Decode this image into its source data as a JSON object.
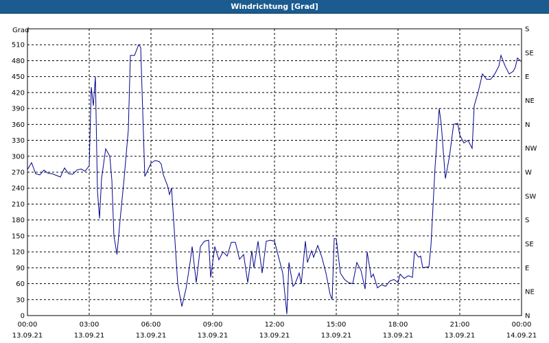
{
  "window": {
    "title": "Windrichtung [Grad]"
  },
  "colors": {
    "titlebar": "#1b5b8f",
    "series": "#00008b",
    "grid": "#000000",
    "background": "#ffffff"
  },
  "chart_data": {
    "type": "line",
    "title": "Windrichtung [Grad]",
    "ylabel": "Grad",
    "xlabel": "",
    "ylim": [
      0,
      540
    ],
    "y_ticks": [
      0,
      30,
      60,
      90,
      120,
      150,
      180,
      210,
      240,
      270,
      300,
      330,
      360,
      390,
      420,
      450,
      480,
      510
    ],
    "right_labels": [
      {
        "y": 0,
        "label": "N"
      },
      {
        "y": 45,
        "label": "NE"
      },
      {
        "y": 90,
        "label": "E"
      },
      {
        "y": 135,
        "label": "SE"
      },
      {
        "y": 180,
        "label": "S"
      },
      {
        "y": 225,
        "label": "SW"
      },
      {
        "y": 270,
        "label": "W"
      },
      {
        "y": 315,
        "label": "NW"
      },
      {
        "y": 360,
        "label": "N"
      },
      {
        "y": 405,
        "label": "NE"
      },
      {
        "y": 450,
        "label": "E"
      },
      {
        "y": 495,
        "label": "SE"
      },
      {
        "y": 540,
        "label": "S"
      }
    ],
    "x_ticks": [
      {
        "h": 0,
        "time": "00:00",
        "date": "13.09.21"
      },
      {
        "h": 3,
        "time": "03:00",
        "date": "13.09.21"
      },
      {
        "h": 6,
        "time": "06:00",
        "date": "13.09.21"
      },
      {
        "h": 9,
        "time": "09:00",
        "date": "13.09.21"
      },
      {
        "h": 12,
        "time": "12:00",
        "date": "13.09.21"
      },
      {
        "h": 15,
        "time": "15:00",
        "date": "13.09.21"
      },
      {
        "h": 18,
        "time": "18:00",
        "date": "13.09.21"
      },
      {
        "h": 21,
        "time": "21:00",
        "date": "13.09.21"
      },
      {
        "h": 24,
        "time": "00:00",
        "date": "14.09.21"
      }
    ],
    "grid": true,
    "series": [
      {
        "x_unit": "hours since 13.09.21 00:00",
        "points": [
          [
            0.0,
            275
          ],
          [
            0.2,
            288
          ],
          [
            0.4,
            267
          ],
          [
            0.6,
            265
          ],
          [
            0.8,
            274
          ],
          [
            1.0,
            268
          ],
          [
            1.2,
            267
          ],
          [
            1.4,
            264
          ],
          [
            1.6,
            261
          ],
          [
            1.8,
            278
          ],
          [
            2.0,
            267
          ],
          [
            2.2,
            266
          ],
          [
            2.4,
            274
          ],
          [
            2.6,
            276
          ],
          [
            2.8,
            272
          ],
          [
            3.0,
            282
          ],
          [
            3.1,
            430
          ],
          [
            3.2,
            395
          ],
          [
            3.3,
            450
          ],
          [
            3.4,
            235
          ],
          [
            3.5,
            183
          ],
          [
            3.6,
            258
          ],
          [
            3.8,
            314
          ],
          [
            4.0,
            300
          ],
          [
            4.1,
            255
          ],
          [
            4.2,
            150
          ],
          [
            4.35,
            115
          ],
          [
            4.5,
            180
          ],
          [
            4.7,
            260
          ],
          [
            4.9,
            350
          ],
          [
            5.0,
            490
          ],
          [
            5.2,
            490
          ],
          [
            5.4,
            510
          ],
          [
            5.5,
            505
          ],
          [
            5.7,
            262
          ],
          [
            5.8,
            270
          ],
          [
            6.0,
            287
          ],
          [
            6.2,
            292
          ],
          [
            6.4,
            290
          ],
          [
            6.5,
            285
          ],
          [
            6.6,
            265
          ],
          [
            6.8,
            245
          ],
          [
            6.9,
            228
          ],
          [
            7.0,
            240
          ],
          [
            7.1,
            180
          ],
          [
            7.3,
            60
          ],
          [
            7.5,
            17
          ],
          [
            7.7,
            50
          ],
          [
            7.9,
            100
          ],
          [
            8.0,
            130
          ],
          [
            8.2,
            62
          ],
          [
            8.4,
            130
          ],
          [
            8.6,
            140
          ],
          [
            8.8,
            142
          ],
          [
            8.9,
            72
          ],
          [
            9.1,
            130
          ],
          [
            9.3,
            105
          ],
          [
            9.5,
            120
          ],
          [
            9.7,
            112
          ],
          [
            9.9,
            138
          ],
          [
            10.1,
            138
          ],
          [
            10.3,
            106
          ],
          [
            10.5,
            115
          ],
          [
            10.7,
            62
          ],
          [
            10.9,
            122
          ],
          [
            11.0,
            90
          ],
          [
            11.2,
            140
          ],
          [
            11.4,
            80
          ],
          [
            11.6,
            140
          ],
          [
            11.8,
            142
          ],
          [
            12.0,
            140
          ],
          [
            12.2,
            110
          ],
          [
            12.4,
            80
          ],
          [
            12.5,
            42
          ],
          [
            12.6,
            3
          ],
          [
            12.7,
            100
          ],
          [
            12.9,
            55
          ],
          [
            13.0,
            60
          ],
          [
            13.2,
            80
          ],
          [
            13.3,
            60
          ],
          [
            13.5,
            140
          ],
          [
            13.6,
            100
          ],
          [
            13.8,
            122
          ],
          [
            13.9,
            110
          ],
          [
            14.1,
            132
          ],
          [
            14.3,
            110
          ],
          [
            14.5,
            80
          ],
          [
            14.7,
            40
          ],
          [
            14.8,
            30
          ],
          [
            14.9,
            145
          ],
          [
            15.0,
            145
          ],
          [
            15.2,
            80
          ],
          [
            15.4,
            68
          ],
          [
            15.6,
            62
          ],
          [
            15.8,
            60
          ],
          [
            16.0,
            100
          ],
          [
            16.2,
            85
          ],
          [
            16.4,
            50
          ],
          [
            16.5,
            120
          ],
          [
            16.7,
            72
          ],
          [
            16.8,
            78
          ],
          [
            17.0,
            52
          ],
          [
            17.2,
            58
          ],
          [
            17.4,
            55
          ],
          [
            17.6,
            65
          ],
          [
            17.8,
            68
          ],
          [
            18.0,
            62
          ],
          [
            18.1,
            78
          ],
          [
            18.3,
            70
          ],
          [
            18.5,
            75
          ],
          [
            18.7,
            72
          ],
          [
            18.8,
            120
          ],
          [
            19.0,
            110
          ],
          [
            19.1,
            112
          ],
          [
            19.2,
            90
          ],
          [
            19.5,
            92
          ],
          [
            19.6,
            132
          ],
          [
            19.8,
            280
          ],
          [
            20.0,
            390
          ],
          [
            20.1,
            360
          ],
          [
            20.3,
            258
          ],
          [
            20.5,
            300
          ],
          [
            20.7,
            360
          ],
          [
            20.9,
            362
          ],
          [
            21.0,
            340
          ],
          [
            21.2,
            325
          ],
          [
            21.4,
            330
          ],
          [
            21.6,
            315
          ],
          [
            21.7,
            395
          ],
          [
            21.9,
            422
          ],
          [
            22.1,
            455
          ],
          [
            22.3,
            445
          ],
          [
            22.5,
            445
          ],
          [
            22.7,
            455
          ],
          [
            22.9,
            470
          ],
          [
            23.0,
            490
          ],
          [
            23.2,
            470
          ],
          [
            23.4,
            455
          ],
          [
            23.6,
            460
          ],
          [
            23.7,
            468
          ],
          [
            23.8,
            485
          ],
          [
            24.0,
            478
          ]
        ]
      }
    ]
  }
}
